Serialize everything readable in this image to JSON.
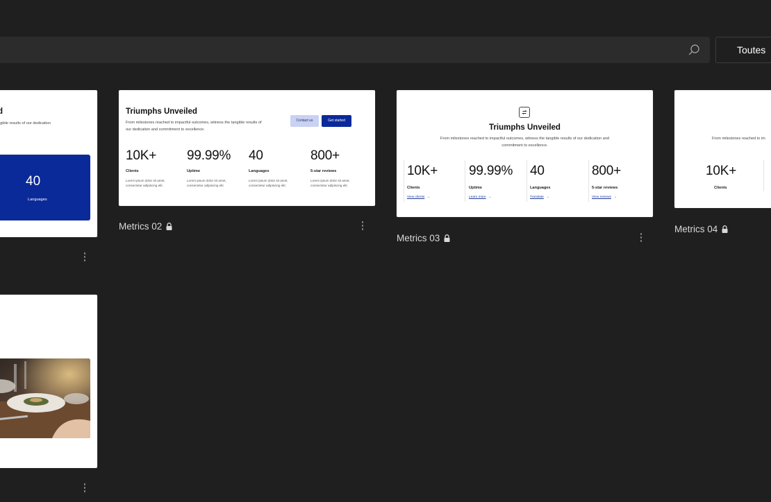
{
  "search": {
    "placeholder": ""
  },
  "filter": {
    "label": "Toutes"
  },
  "preview": {
    "title": "Triumphs Unveiled",
    "title_cut": "d",
    "description": "From milestones reached to impactful outcomes, witness the tangible results of our dedication and commitment to excellence.",
    "description_cut": "ngible results of our dedication",
    "description_04": "From milestones reached to im",
    "contact_label": "Contact us",
    "start_label": "Get started",
    "lorem": "Lorem ipsum dolor sit amet, consectetur adipiscing elit.",
    "highlight_value": "40",
    "highlight_label": "Languages",
    "stats": [
      {
        "value": "10K+",
        "label": "Clients",
        "link": "View clients"
      },
      {
        "value": "99.99%",
        "label": "Uptime",
        "link": "Learn more"
      },
      {
        "value": "40",
        "label": "Languages",
        "link": "Translate"
      },
      {
        "value": "800+",
        "label": "5-star reviews",
        "link": "View reviews"
      }
    ]
  },
  "cards": [
    {
      "name": ""
    },
    {
      "name": "Metrics 02"
    },
    {
      "name": "Metrics 03"
    },
    {
      "name": "Metrics 04"
    },
    {
      "name": ""
    }
  ],
  "icons": {
    "search": "search-icon",
    "lock": "lock-icon",
    "more": "more-vertical-icon",
    "swap": "swap-icon"
  },
  "colors": {
    "background": "#1f1f1f",
    "accent_blue": "#0b2a9a",
    "light_blue": "#c9d2f2"
  }
}
